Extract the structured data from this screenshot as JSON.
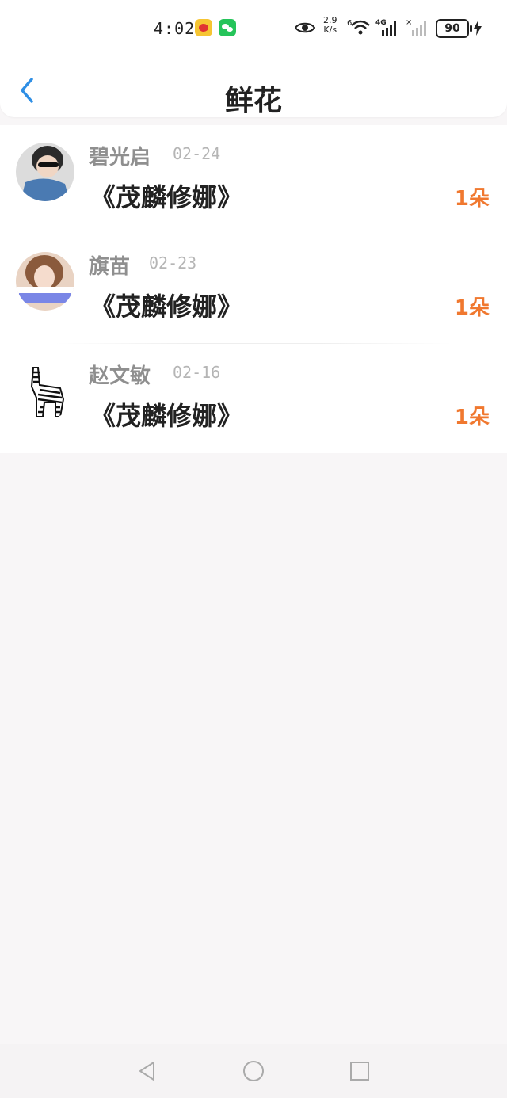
{
  "status_bar": {
    "time": "4:02",
    "speed_value": "2.9",
    "speed_unit": "K/s",
    "wifi_label": "6",
    "network_label": "4G",
    "battery": "90"
  },
  "header": {
    "title": "鲜花"
  },
  "items": [
    {
      "name": "碧光启",
      "date": "02-24",
      "gift": "《茂麟修娜》",
      "count": "1朵"
    },
    {
      "name": "旗苗",
      "date": "02-23",
      "gift": "《茂麟修娜》",
      "count": "1朵"
    },
    {
      "name": "赵文敏",
      "date": "02-16",
      "gift": "《茂麟修娜》",
      "count": "1朵"
    }
  ],
  "icons": {
    "back": "back-chevron-icon",
    "eye": "eye-icon",
    "wifi": "wifi-icon",
    "signal": "signal-icon",
    "battery": "battery-icon",
    "charging": "bolt-icon"
  },
  "colors": {
    "accent_blue": "#2f8fe5",
    "count_orange": "#f0782f",
    "name_gray": "#8f8f8f"
  }
}
